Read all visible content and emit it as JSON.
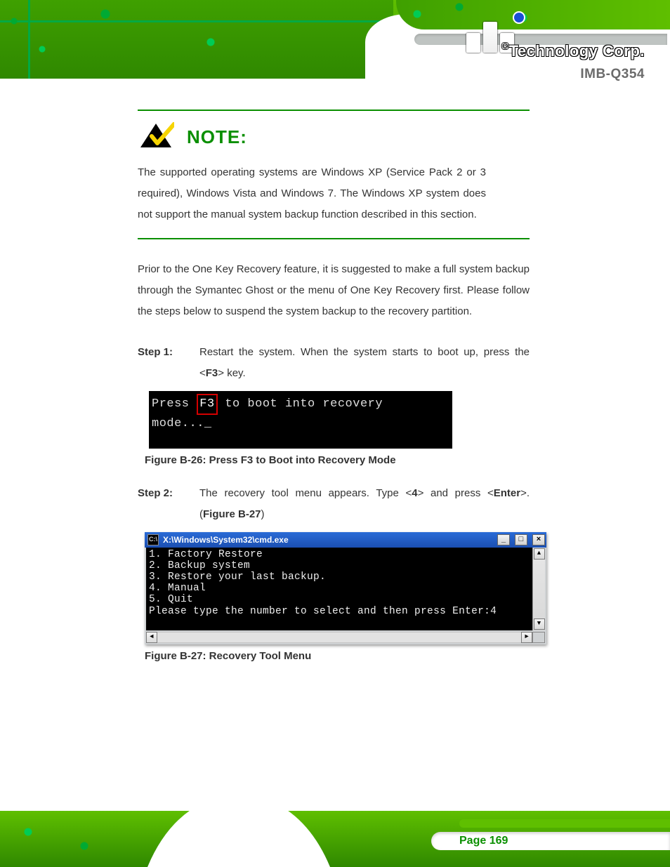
{
  "header": {
    "brand_registered": "®",
    "brand_text": "Technology Corp.",
    "doc_title": "IMB-Q354"
  },
  "note": {
    "title": "NOTE:",
    "body": "The supported operating systems are Windows XP (Service Pack 2 or 3 required), Windows Vista and Windows 7. The Windows XP system does not support the manual system backup function described in this section."
  },
  "intro": "Prior to the One Key Recovery feature, it is suggested to make a full system backup through the Symantec Ghost or the menu of One Key Recovery first. Please follow the steps below to suspend the system backup to the recovery partition.",
  "step1": {
    "label": "Step 1:",
    "body_a": "Restart the system. When the system starts to boot up, press the <",
    "body_key": "F3",
    "body_b": "> key."
  },
  "fig1": {
    "pre": "Press ",
    "key": "F3",
    "post": " to boot into recovery mode..._",
    "caption": "Figure B-26: Press F3 to Boot into Recovery Mode"
  },
  "step2": {
    "label": "Step 2:",
    "body_a": "The recovery tool menu appears. Type <",
    "body_key": "4",
    "body_b": "> and press <",
    "body_key2": "Enter",
    "body_c": ">. (",
    "body_ref": "Figure B-27",
    "body_d": ")"
  },
  "cmd": {
    "title": "X:\\Windows\\System32\\cmd.exe",
    "line1": "1. Factory Restore",
    "line2": "2. Backup system",
    "line3": "3. Restore your last backup.",
    "line4": "4. Manual",
    "line5": "5. Quit",
    "prompt": "Please type the number to select and then press Enter:4"
  },
  "fig2_caption": "Figure B-27: Recovery Tool Menu",
  "footer": {
    "page": "Page 169"
  }
}
